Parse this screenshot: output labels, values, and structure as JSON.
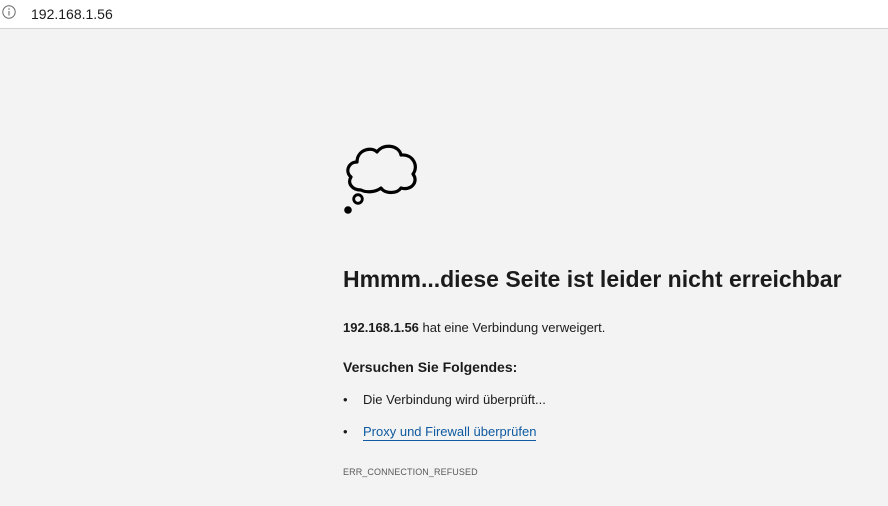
{
  "address_bar": {
    "icon": "info-icon",
    "url": "192.168.1.56"
  },
  "error_page": {
    "icon": "thought-bubble-icon",
    "title": "Hmmm...diese Seite ist leider nicht erreichbar",
    "message_host": "192.168.1.56",
    "message_text": " hat eine Verbindung verweigert.",
    "try_heading": "Versuchen Sie Folgendes:",
    "suggestions": [
      {
        "bullet": "•",
        "text": "Die Verbindung wird überprüft..."
      },
      {
        "bullet": "•",
        "text": "Proxy und Firewall überprüfen"
      }
    ],
    "error_code": "ERR_CONNECTION_REFUSED",
    "link_color": "#0f5aa0"
  }
}
